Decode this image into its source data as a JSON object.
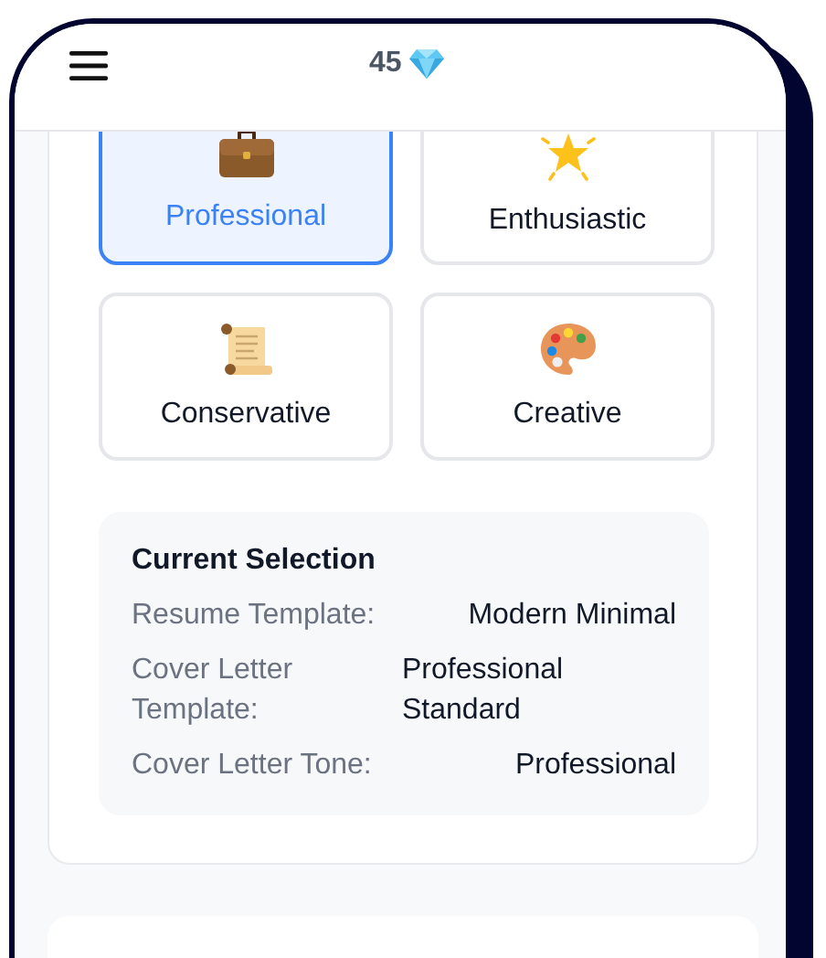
{
  "header": {
    "gem_count": "45"
  },
  "tones": [
    {
      "label": "Professional",
      "selected": true
    },
    {
      "label": "Enthusiastic",
      "selected": false
    },
    {
      "label": "Conservative",
      "selected": false
    },
    {
      "label": "Creative",
      "selected": false
    }
  ],
  "current_selection": {
    "title": "Current Selection",
    "rows": [
      {
        "label": "Resume Template:",
        "value": "Modern Minimal"
      },
      {
        "label": "Cover Letter Template:",
        "value": "Professional Standard"
      },
      {
        "label": "Cover Letter Tone:",
        "value": "Professional"
      }
    ]
  }
}
